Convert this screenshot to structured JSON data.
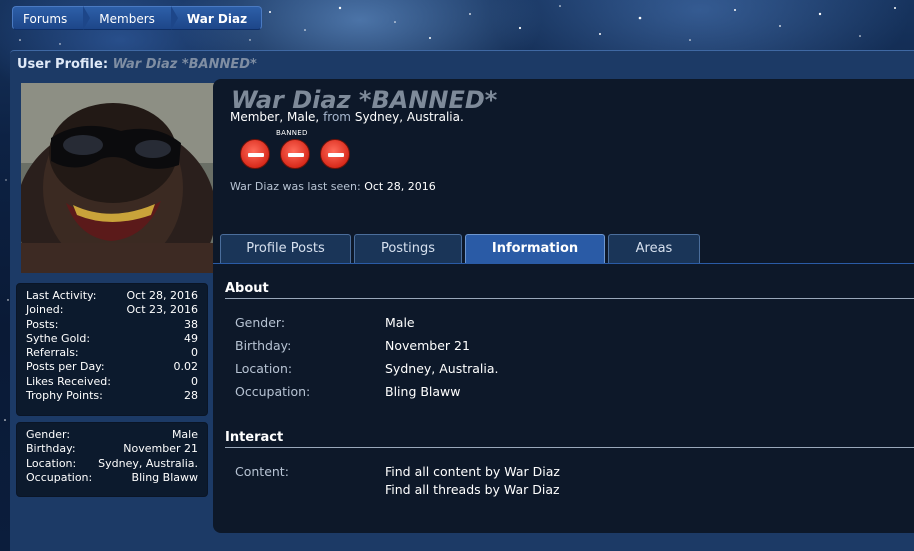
{
  "breadcrumb": {
    "items": [
      "Forums",
      "Members",
      "War Diaz"
    ]
  },
  "header": {
    "title_prefix": "User Profile:",
    "title_name": "War Diaz *BANNED*"
  },
  "sidebar": {
    "stats": [
      {
        "label": "Last Activity:",
        "value": "Oct 28, 2016"
      },
      {
        "label": "Joined:",
        "value": "Oct 23, 2016"
      },
      {
        "label": "Posts:",
        "value": "38"
      },
      {
        "label": "Sythe Gold:",
        "value": "49"
      },
      {
        "label": "Referrals:",
        "value": "0"
      },
      {
        "label": "Posts per Day:",
        "value": "0.02"
      },
      {
        "label": "Likes Received:",
        "value": "0"
      },
      {
        "label": "Trophy Points:",
        "value": "28"
      }
    ],
    "details": [
      {
        "label": "Gender:",
        "value": "Male"
      },
      {
        "label": "Birthday:",
        "value": "November 21"
      },
      {
        "label": "Location:",
        "value": "Sydney, Australia."
      },
      {
        "label": "Occupation:",
        "value": "Bling Blaww"
      }
    ]
  },
  "profile": {
    "username": "War Diaz *BANNED*",
    "member": "Member, Male,",
    "from_word": "from",
    "location": "Sydney, Australia.",
    "badge_label": "BANNED",
    "last_seen_label": "War Diaz was last seen:",
    "last_seen_value": "Oct 28, 2016"
  },
  "tabs": [
    {
      "label": "Profile Posts",
      "active": false
    },
    {
      "label": "Postings",
      "active": false
    },
    {
      "label": "Information",
      "active": true
    },
    {
      "label": "Areas",
      "active": false
    }
  ],
  "about": {
    "heading": "About",
    "rows": [
      {
        "label": "Gender:",
        "value": "Male"
      },
      {
        "label": "Birthday:",
        "value": "November 21"
      },
      {
        "label": "Location:",
        "value": "Sydney, Australia."
      },
      {
        "label": "Occupation:",
        "value": "Bling Blaww"
      }
    ]
  },
  "interact": {
    "heading": "Interact",
    "content_label": "Content:",
    "links": [
      "Find all content by War Diaz",
      "Find all threads by War Diaz"
    ]
  },
  "colors": {
    "accent": "#2a5ba6",
    "banned_badge": "#d92b1c",
    "panel": "#0d1829"
  }
}
